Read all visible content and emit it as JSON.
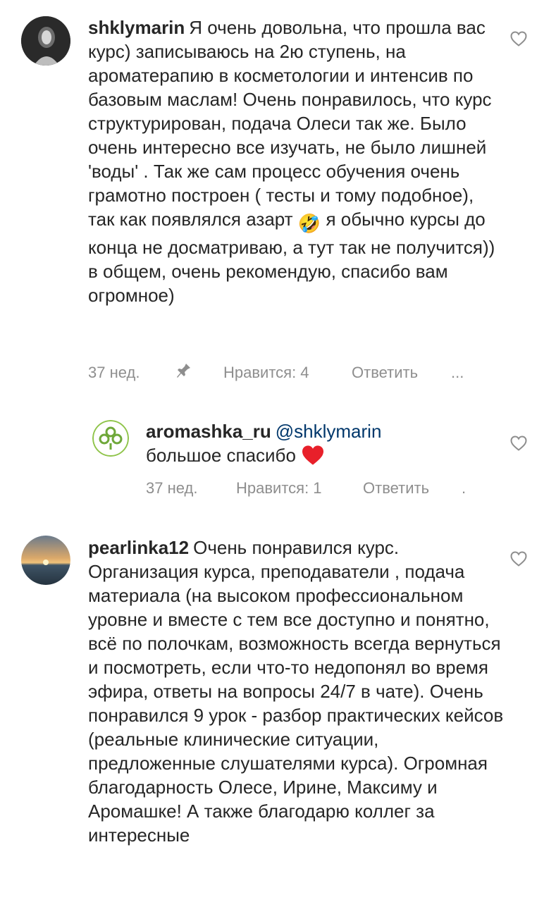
{
  "comments": [
    {
      "username": "shklymarin",
      "text": "Я очень довольна, что прошла вас курс) записываюсь на 2ю ступень, на ароматерапию в косметологии и интенсив по базовым маслам! Очень понравилось, что курс структурирован, подача Олеси так же. Было очень интересно все изучать, не было лишней 'воды' . Так же сам процесс обучения очень грамотно построен ( тесты и тому подобное), так как появлялся азарт",
      "emoji": "🤣",
      "text_after": "я обычно курсы до конца не досматриваю, а тут так не получится)) в общем, очень рекомендую, спасибо вам огромное)",
      "time": "37 нед.",
      "likes": "Нравится: 4",
      "reply": "Ответить",
      "more": "..."
    },
    {
      "username": "aromashka_ru",
      "mention": "@shklymarin",
      "text": "большое спасибо",
      "emoji": "❤️",
      "time": "37 нед.",
      "likes": "Нравится: 1",
      "reply": "Ответить",
      "more": "."
    },
    {
      "username": "pearlinka12",
      "text": "Очень понравился курс. Организация курса, преподаватели , подача материала (на высоком профессиональном уровне и вместе с тем все доступно и понятно, всё по полочкам, возможность всегда вернуться и посмотреть, если что-то недопонял во время эфира, ответы на вопросы 24/7 в чате). Очень понравился 9 урок - разбор практических кейсов (реальные клинические ситуации, предложенные слушателями курса). Огромная благодарность Олесе, Ирине, Максиму и Аромашке! А также благодарю коллег за интересные"
    }
  ]
}
